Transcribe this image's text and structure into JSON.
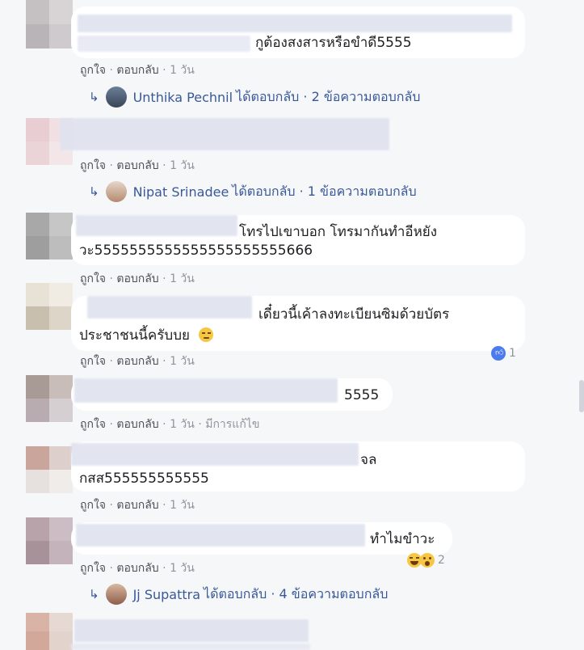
{
  "comments": [
    {
      "id": 1,
      "text": "กูต้องสงสารหรือขำดี5555",
      "actions": {
        "like": "ถูกใจ",
        "reply": "ตอบกลับ",
        "time": "1 วัน"
      },
      "reply_link": {
        "name": "Unthika Pechnil",
        "rest": "ได้ตอบกลับ · 2 ข้อความตอบกลับ"
      }
    },
    {
      "id": 2,
      "actions": {
        "like": "ถูกใจ",
        "reply": "ตอบกลับ",
        "time": "1 วัน"
      },
      "reply_link": {
        "name": "Nipat Srinadee",
        "rest": "ได้ตอบกลับ · 1 ข้อความตอบกลับ"
      }
    },
    {
      "id": 3,
      "line1": "โทรไปเขาบอก โทรมากันทำอีหยัง",
      "line2": "วะ5555555555555555555555666",
      "actions": {
        "like": "ถูกใจ",
        "reply": "ตอบกลับ",
        "time": "1 วัน"
      }
    },
    {
      "id": 4,
      "line1": "เดี๋ยวนี้เค้าลงทะเบียนซิมด้วยบัตร",
      "line2": "ประชาชนนี้ครับบย",
      "actions": {
        "like": "ถูกใจ",
        "reply": "ตอบกลับ",
        "time": "1 วัน"
      },
      "reaction": {
        "icons": [
          "like-icon"
        ],
        "count": "1"
      }
    },
    {
      "id": 5,
      "text": "5555",
      "actions": {
        "like": "ถูกใจ",
        "reply": "ตอบกลับ",
        "time": "1 วัน",
        "edited": "มีการแก้ไข"
      }
    },
    {
      "id": 6,
      "line1": "จล",
      "line2": "กสส555555555555",
      "actions": {
        "like": "ถูกใจ",
        "reply": "ตอบกลับ",
        "time": "1 วัน"
      }
    },
    {
      "id": 7,
      "text": "ทำไมขำวะ",
      "actions": {
        "like": "ถูกใจ",
        "reply": "ตอบกลับ",
        "time": "1 วัน"
      },
      "reaction": {
        "icons": [
          "haha-icon",
          "wow-icon"
        ],
        "count": "2"
      },
      "reply_link": {
        "name": "Jj Supattra",
        "rest": "ได้ตอบกลับ · 4 ข้อความตอบกลับ"
      }
    }
  ],
  "colors": {
    "link": "#385898",
    "meta": "#90949c",
    "bubble": "#ffffff",
    "background": "#f6f7f9",
    "like_blue": "#4b7bec"
  }
}
